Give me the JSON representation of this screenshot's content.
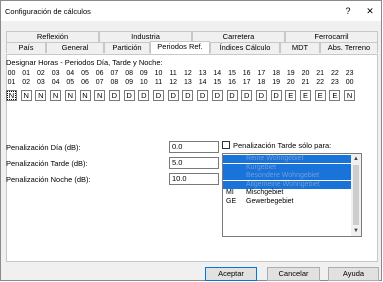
{
  "window": {
    "title": "Configuración de cálculos",
    "help_label": "?",
    "close_label": "✕"
  },
  "tabs_back": [
    {
      "label": "Reflexión"
    },
    {
      "label": "Industria"
    },
    {
      "label": "Carretera"
    },
    {
      "label": "Ferrocarril"
    }
  ],
  "tabs_front": [
    {
      "label": "País"
    },
    {
      "label": "General"
    },
    {
      "label": "Partición"
    },
    {
      "label": "Periodos Ref."
    },
    {
      "label": "Índices Cálculo"
    },
    {
      "label": "MDT"
    },
    {
      "label": "Abs. Terreno"
    }
  ],
  "active_tab": "Periodos Ref.",
  "periods": {
    "heading": "Designar Horas - Periodos Día, Tarde y Noche:",
    "start_hours": [
      "00",
      "01",
      "02",
      "03",
      "04",
      "05",
      "06",
      "07",
      "08",
      "09",
      "10",
      "11",
      "12",
      "13",
      "14",
      "15",
      "16",
      "17",
      "18",
      "19",
      "20",
      "21",
      "22",
      "23"
    ],
    "end_hours": [
      "01",
      "02",
      "03",
      "04",
      "05",
      "06",
      "07",
      "08",
      "09",
      "10",
      "11",
      "12",
      "13",
      "14",
      "15",
      "16",
      "17",
      "18",
      "19",
      "20",
      "21",
      "22",
      "23",
      "00"
    ],
    "codes": [
      "N",
      "N",
      "N",
      "N",
      "N",
      "N",
      "N",
      "D",
      "D",
      "D",
      "D",
      "D",
      "D",
      "D",
      "D",
      "D",
      "D",
      "D",
      "D",
      "E",
      "E",
      "E",
      "E",
      "N"
    ]
  },
  "penalties": {
    "day_label": "Penalización Día (dB):",
    "day_value": "0.0",
    "evening_label": "Penalización Tarde (dB):",
    "evening_value": "5.0",
    "night_label": "Penalización Noche (dB):",
    "night_value": "10.0"
  },
  "evening_only": {
    "label": "Penalización Tarde sólo para:",
    "checked": false,
    "items": [
      {
        "code": "",
        "desc": "Reine Wohngebiet",
        "selected": true
      },
      {
        "code": "",
        "desc": "Kurgebiet",
        "selected": true
      },
      {
        "code": "",
        "desc": "Besondere Wohngebiet",
        "selected": true
      },
      {
        "code": "",
        "desc": "Allgemeine Wohngebiet",
        "selected": true
      },
      {
        "code": "MI",
        "desc": "Mischgebiet",
        "selected": false
      },
      {
        "code": "GE",
        "desc": "Gewerbegebiet",
        "selected": false
      }
    ],
    "scroll_up": "▲",
    "scroll_down": "▼"
  },
  "buttons": {
    "accept": "Aceptar",
    "cancel": "Cancelar",
    "help": "Ayuda"
  },
  "colors": {
    "selection": "#1a73d8",
    "dialog_bg": "#f0f0f0",
    "default_border": "#0078d7"
  }
}
